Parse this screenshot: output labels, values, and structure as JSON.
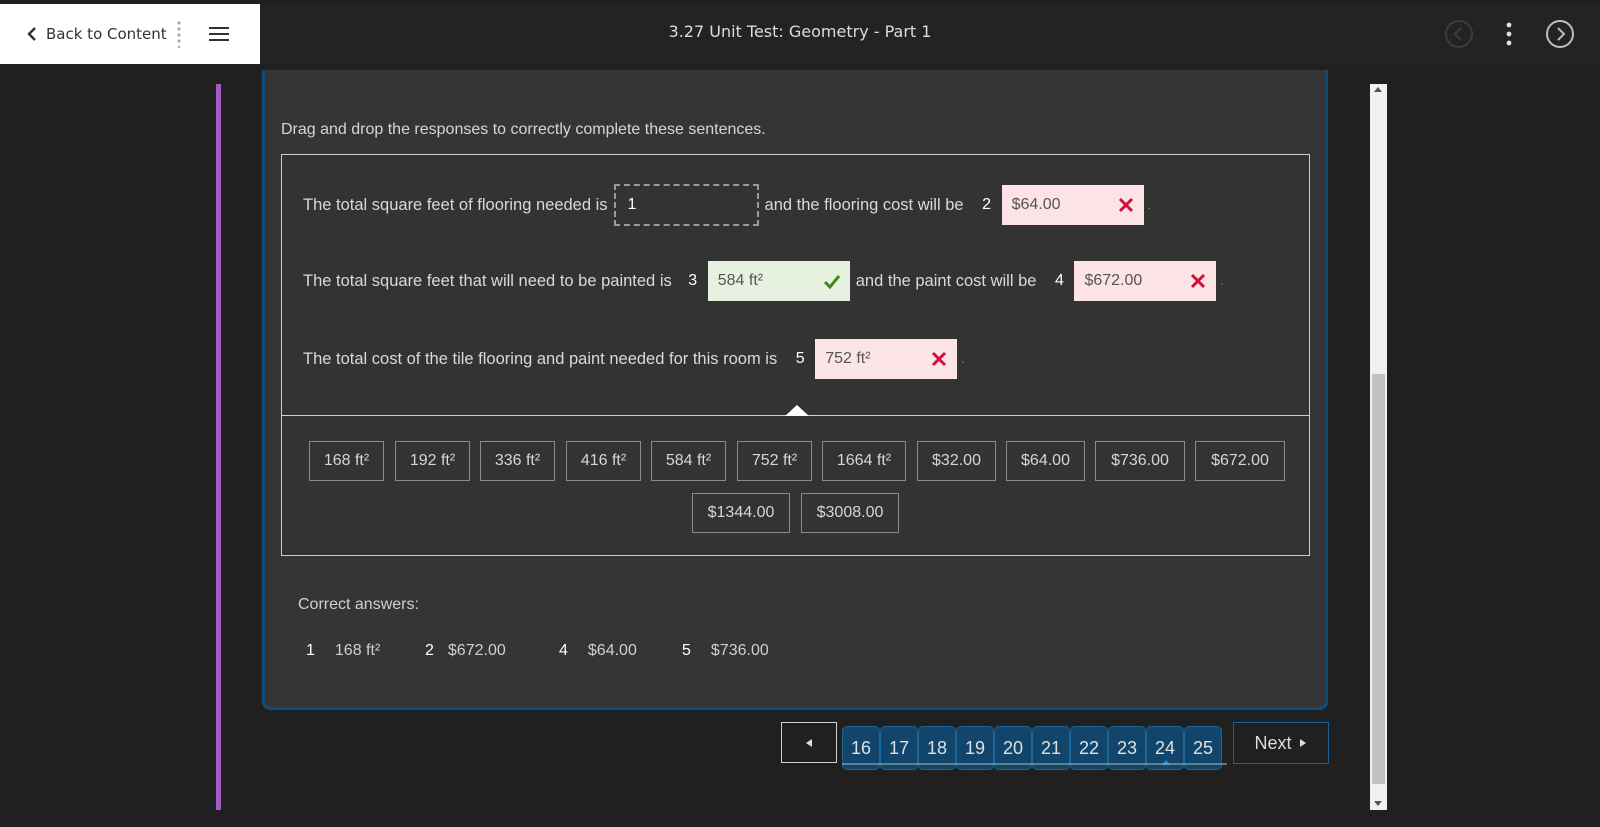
{
  "header": {
    "back_label": "Back to Content",
    "title": "3.27 Unit Test: Geometry - Part 1"
  },
  "question": {
    "instructions": "Drag and drop the responses to correctly complete these sentences.",
    "rows": [
      {
        "prefix": "The total square feet of flooring needed is",
        "blank1_num": "1",
        "blank1_value": "1",
        "middle": "and the flooring cost will be",
        "blank2_num": "2",
        "blank2_value": "$64.00",
        "blank2_state": "wrong"
      },
      {
        "prefix": "The total square feet that will need to be painted is",
        "blank1_num": "3",
        "blank1_value": "584 ft²",
        "blank1_state": "correct",
        "middle": "and the paint cost will be",
        "blank2_num": "4",
        "blank2_value": "$672.00",
        "blank2_state": "wrong"
      },
      {
        "prefix": "The total cost of the tile flooring and paint needed for this room is",
        "blank1_num": "5",
        "blank1_value": "752 ft²",
        "blank1_state": "wrong"
      }
    ],
    "choices": [
      "168 ft²",
      "192 ft²",
      "336 ft²",
      "416 ft²",
      "584 ft²",
      "752 ft²",
      "1664 ft²",
      "$32.00",
      "$64.00",
      "$736.00",
      "$672.00",
      "$1344.00",
      "$3008.00"
    ]
  },
  "correct_answers": {
    "title": "Correct answers:",
    "items": [
      {
        "num": "1",
        "value": "168 ft²"
      },
      {
        "num": "2",
        "value": "$672.00"
      },
      {
        "num": "4",
        "value": "$64.00"
      },
      {
        "num": "5",
        "value": "$736.00"
      }
    ]
  },
  "pager": {
    "pages": [
      "16",
      "17",
      "18",
      "19",
      "20",
      "21",
      "22",
      "23",
      "24",
      "25"
    ],
    "active": "24",
    "next_label": "Next"
  },
  "colors": {
    "accent_purple": "#a35bc4",
    "panel_border": "#0e4d79",
    "wrong_bg": "#fbe3e6",
    "correct_bg": "#e6f2df",
    "wrong_mark": "#d0103a",
    "correct_mark": "#3f8a1c"
  }
}
